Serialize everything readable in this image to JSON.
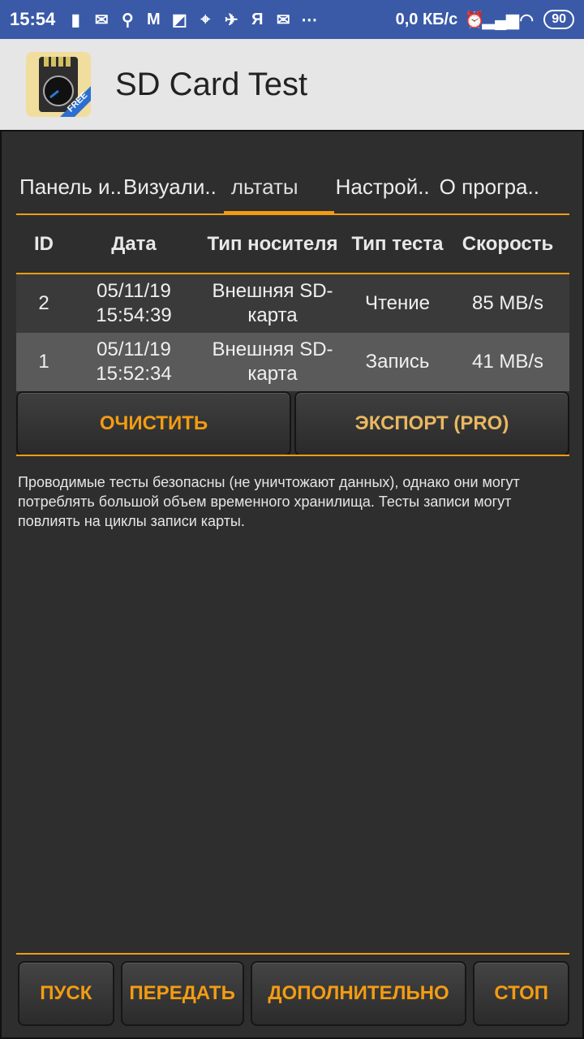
{
  "status_bar": {
    "time": "15:54",
    "net_speed": "0,0 КБ/с",
    "battery": "90",
    "icons": [
      "sd-card-icon",
      "message-icon",
      "keyhole-icon",
      "gmail-icon",
      "document-icon",
      "maps-icon",
      "feather-icon",
      "yandex-icon",
      "mail-icon",
      "more-icon",
      "alarm-off-icon",
      "signal-icon",
      "wifi-icon"
    ]
  },
  "app_bar": {
    "title": "SD Card Test",
    "badge": "FREE"
  },
  "tabs": [
    {
      "label": "Панель и.."
    },
    {
      "label": "Визуали.."
    },
    {
      "label": "льтаты"
    },
    {
      "label": "Настрой.."
    },
    {
      "label": "О програ.."
    }
  ],
  "table": {
    "headers": {
      "id": "ID",
      "date": "Дата",
      "media": "Тип носителя",
      "test": "Тип теста",
      "speed": "Скорость"
    },
    "rows": [
      {
        "id": "2",
        "date": "05/11/19 15:54:39",
        "media": "Внешняя SD-карта",
        "test": "Чтение",
        "speed": "85 MB/s"
      },
      {
        "id": "1",
        "date": "05/11/19 15:52:34",
        "media": "Внешняя SD-карта",
        "test": "Запись",
        "speed": "41 MB/s"
      }
    ]
  },
  "actions": {
    "clear": "ОЧИСТИТЬ",
    "export": "ЭКСПОРТ (PRO)"
  },
  "notice": "Проводимые тесты безопасны (не уничтожают данных), однако они могут потреблять большой объем временного хранилища. Тесты записи могут повлиять на циклы записи карты.",
  "bottom": {
    "start": "ПУСК",
    "send": "ПЕРЕДАТЬ",
    "more": "ДОПОЛНИТЕЛЬНО",
    "stop": "СТОП"
  },
  "colors": {
    "accent": "#f39c12",
    "status_bar": "#3a5aa8"
  }
}
